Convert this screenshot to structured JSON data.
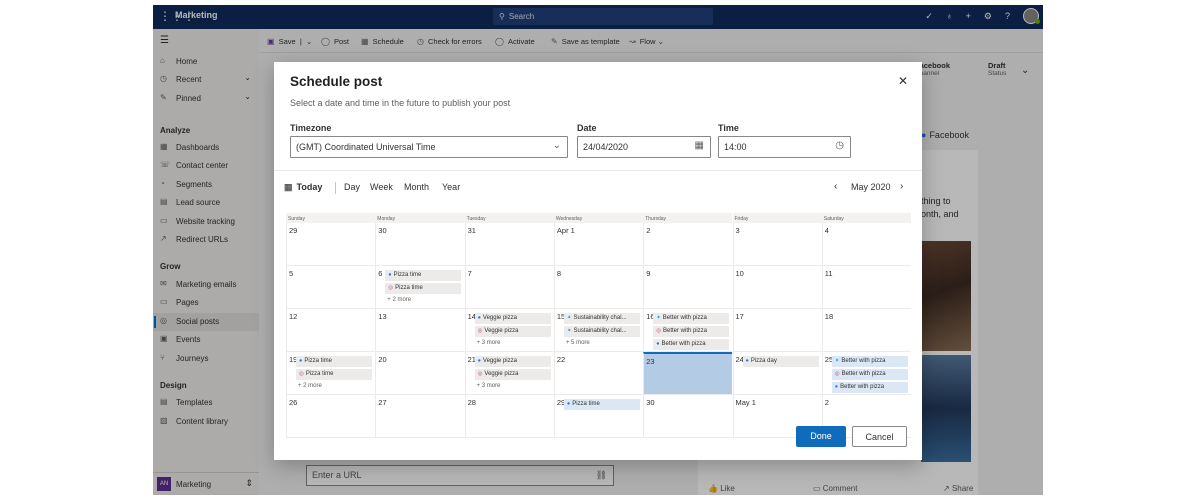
{
  "topbar": {
    "app_name": "Marketing",
    "search_placeholder": "Search"
  },
  "sidebar": {
    "items_top": [
      {
        "label": "Home",
        "icon": "home-icon"
      },
      {
        "label": "Recent",
        "icon": "clock-icon"
      },
      {
        "label": "Pinned",
        "icon": "pin-icon"
      }
    ],
    "sections": [
      {
        "title": "Analyze",
        "items": [
          "Dashboards",
          "Contact center",
          "Segments",
          "Lead source",
          "Website tracking",
          "Redirect URLs"
        ]
      },
      {
        "title": "Grow",
        "items": [
          "Marketing emails",
          "Pages",
          "Social posts",
          "Events",
          "Journeys"
        ]
      },
      {
        "title": "Design",
        "items": [
          "Templates",
          "Content library"
        ]
      }
    ],
    "area_badge": "AN",
    "area_label": "Marketing"
  },
  "commands": [
    "Save",
    "Post",
    "Schedule",
    "Check for errors",
    "Activate",
    "Save as template",
    "Flow"
  ],
  "header": {
    "channel_value": "Facebook",
    "channel_label": "Channel",
    "status_value": "Draft",
    "status_label": "Status"
  },
  "preview": {
    "network": "Facebook",
    "text_line1": "thing to",
    "text_line2": "onth, and",
    "actions": [
      "Like",
      "Comment",
      "Share"
    ]
  },
  "url_placeholder": "Enter a URL",
  "dialog": {
    "title": "Schedule post",
    "subtitle": "Select a date and time in the future to publish your post",
    "timezone_label": "Timezone",
    "timezone_value": "(GMT) Coordinated Universal Time",
    "date_label": "Date",
    "date_value": "24/04/2020",
    "time_label": "Time",
    "time_value": "14:00",
    "today_label": "Today",
    "views": [
      "Day",
      "Week",
      "Month",
      "Year"
    ],
    "month_label": "May 2020",
    "done_label": "Done",
    "cancel_label": "Cancel"
  },
  "calendar": {
    "weekdays": [
      "Sunday",
      "Monday",
      "Tuesday",
      "Wednesday",
      "Thursday",
      "Friday",
      "Saturday"
    ],
    "today_index": 25,
    "weeks": [
      [
        {
          "d": "29"
        },
        {
          "d": "30"
        },
        {
          "d": "31"
        },
        {
          "d": "Apr 1"
        },
        {
          "d": "2"
        },
        {
          "d": "3"
        },
        {
          "d": "4"
        }
      ],
      [
        {
          "d": "5"
        },
        {
          "d": "6",
          "events": [
            {
              "icon": "facebook",
              "text": "Pizza time"
            },
            {
              "icon": "instagram",
              "text": "Pizza time"
            }
          ],
          "more": "+ 2 more"
        },
        {
          "d": "7"
        },
        {
          "d": "8"
        },
        {
          "d": "9"
        },
        {
          "d": "10"
        },
        {
          "d": "11"
        }
      ],
      [
        {
          "d": "12"
        },
        {
          "d": "13"
        },
        {
          "d": "14",
          "events": [
            {
              "icon": "facebook",
              "text": "Veggie pizza"
            },
            {
              "icon": "instagram",
              "text": "Veggie pizza"
            }
          ],
          "more": "+ 3 more"
        },
        {
          "d": "15",
          "events": [
            {
              "icon": "twitter",
              "text": "Sustainability chal..."
            },
            {
              "icon": "twitter",
              "text": "Sustainability chal..."
            }
          ],
          "more": "+ 5 more"
        },
        {
          "d": "16",
          "events": [
            {
              "icon": "twitter",
              "text": "Better with pizza"
            },
            {
              "icon": "instagram",
              "text": "Better with pizza"
            },
            {
              "icon": "facebook",
              "text": "Better with pizza"
            }
          ]
        },
        {
          "d": "17"
        },
        {
          "d": "18"
        }
      ],
      [
        {
          "d": "19",
          "events": [
            {
              "icon": "facebook",
              "text": "Pizza time"
            },
            {
              "icon": "instagram",
              "text": "Pizza time"
            }
          ],
          "more": "+ 2 more"
        },
        {
          "d": "20"
        },
        {
          "d": "21",
          "events": [
            {
              "icon": "facebook",
              "text": "Veggie pizza"
            },
            {
              "icon": "instagram",
              "text": "Veggie pizza"
            }
          ],
          "more": "+ 3 more"
        },
        {
          "d": "22"
        },
        {
          "d": "23"
        },
        {
          "d": "24",
          "events": [
            {
              "icon": "facebook",
              "text": "Pizza day"
            }
          ]
        },
        {
          "d": "25",
          "events": [
            {
              "icon": "twitter",
              "text": "Better with pizza",
              "blue": true
            },
            {
              "icon": "instagram",
              "text": "Better with pizza",
              "blue": true
            },
            {
              "icon": "facebook",
              "text": "Better with pizza",
              "blue": true
            }
          ]
        }
      ],
      [
        {
          "d": "26"
        },
        {
          "d": "27"
        },
        {
          "d": "28"
        },
        {
          "d": "29",
          "events": [
            {
              "icon": "facebook",
              "text": "Pizza time",
              "blue": true
            }
          ]
        },
        {
          "d": "30"
        },
        {
          "d": "May 1"
        },
        {
          "d": "2"
        }
      ]
    ]
  },
  "colors": {
    "topbar": "#0f2b5c",
    "accent": "#0f6cbd",
    "today_cell": "#b4cbe6"
  }
}
